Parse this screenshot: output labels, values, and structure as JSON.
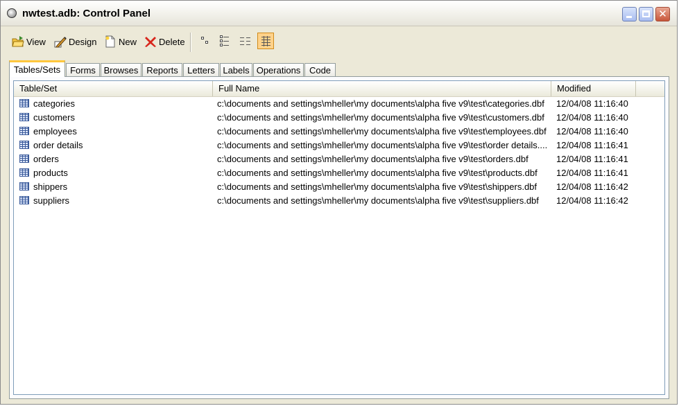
{
  "window": {
    "title": "nwtest.adb: Control Panel"
  },
  "toolbar": {
    "view_label": "View",
    "design_label": "Design",
    "new_label": "New",
    "delete_label": "Delete"
  },
  "tabs": [
    {
      "label": "Tables/Sets",
      "active": true
    },
    {
      "label": "Forms"
    },
    {
      "label": "Browses"
    },
    {
      "label": "Reports"
    },
    {
      "label": "Letters"
    },
    {
      "label": "Labels"
    },
    {
      "label": "Operations"
    },
    {
      "label": "Code"
    }
  ],
  "table": {
    "columns": [
      "Table/Set",
      "Full Name",
      "Modified"
    ],
    "rows": [
      {
        "name": "categories",
        "path": "c:\\documents and settings\\mheller\\my documents\\alpha five v9\\test\\categories.dbf",
        "modified": "12/04/08 11:16:40"
      },
      {
        "name": "customers",
        "path": "c:\\documents and settings\\mheller\\my documents\\alpha five v9\\test\\customers.dbf",
        "modified": "12/04/08 11:16:40"
      },
      {
        "name": "employees",
        "path": "c:\\documents and settings\\mheller\\my documents\\alpha five v9\\test\\employees.dbf",
        "modified": "12/04/08 11:16:40"
      },
      {
        "name": "order details",
        "path": "c:\\documents and settings\\mheller\\my documents\\alpha five v9\\test\\order details....",
        "modified": "12/04/08 11:16:41"
      },
      {
        "name": "orders",
        "path": "c:\\documents and settings\\mheller\\my documents\\alpha five v9\\test\\orders.dbf",
        "modified": "12/04/08 11:16:41"
      },
      {
        "name": "products",
        "path": "c:\\documents and settings\\mheller\\my documents\\alpha five v9\\test\\products.dbf",
        "modified": "12/04/08 11:16:41"
      },
      {
        "name": "shippers",
        "path": "c:\\documents and settings\\mheller\\my documents\\alpha five v9\\test\\shippers.dbf",
        "modified": "12/04/08 11:16:42"
      },
      {
        "name": "suppliers",
        "path": "c:\\documents and settings\\mheller\\my documents\\alpha five v9\\test\\suppliers.dbf",
        "modified": "12/04/08 11:16:42"
      }
    ]
  }
}
